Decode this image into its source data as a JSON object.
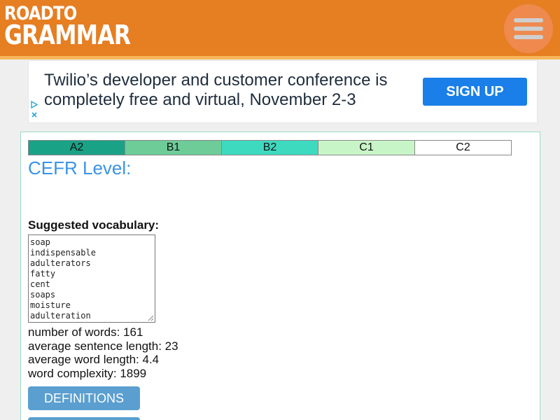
{
  "header": {
    "logo_top": "ROADTO",
    "logo_bottom": "GRAMMAR",
    "menu_icon": "hamburger-icon",
    "bg_color": "#e67e22"
  },
  "ad": {
    "text": "Twilio’s developer and customer conference is completely free and virtual, November 2-3",
    "cta_label": "SIGN UP",
    "cta_color": "#1a7fe8"
  },
  "cefr": {
    "levels": [
      {
        "label": "A2",
        "color": "#1aa287"
      },
      {
        "label": "B1",
        "color": "#6dcc98"
      },
      {
        "label": "B2",
        "color": "#3ddac0"
      },
      {
        "label": "C1",
        "color": "#c8f5c8"
      },
      {
        "label": "C2",
        "color": "#ffffff"
      }
    ],
    "title": "CEFR Level:"
  },
  "vocab": {
    "label": "Suggested vocabulary:",
    "words": [
      "soap",
      "indispensable",
      "adulterators",
      "fatty",
      "cent",
      "soaps",
      "moisture",
      "adulteration"
    ]
  },
  "stats": {
    "words": "number of words: 161",
    "sentence_length": "average sentence length: 23",
    "word_length": "average word length: 4.4",
    "complexity": "word complexity: 1899"
  },
  "buttons": {
    "definitions": "DEFINITIONS"
  }
}
